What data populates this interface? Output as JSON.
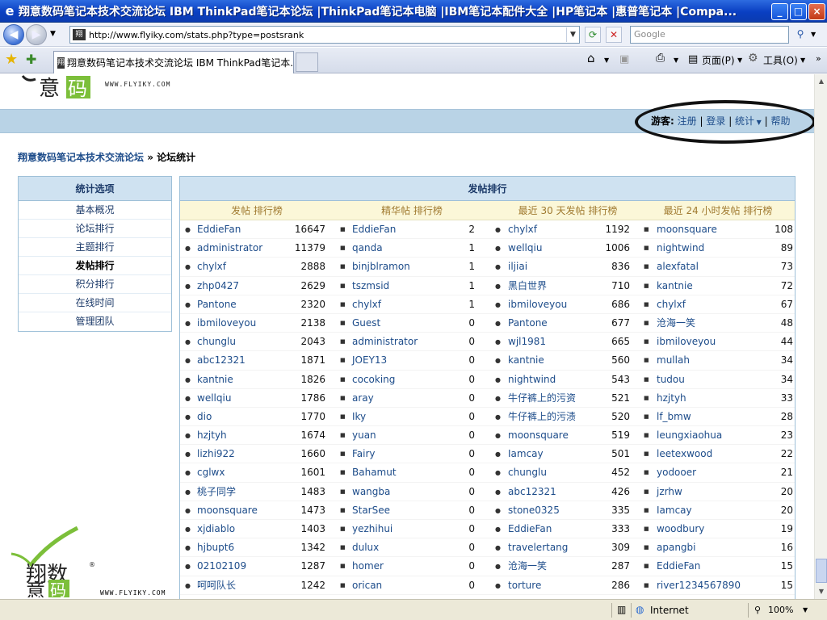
{
  "window": {
    "title": "翔意数码笔记本技术交流论坛 IBM ThinkPad笔记本论坛 |ThinkPad笔记本电脑 |IBM笔记本配件大全 |HP笔记本 |惠普笔记本 |Compa...",
    "app_icon": "ie-icon"
  },
  "browser": {
    "url": "http://www.flyiky.com/stats.php?type=postsrank",
    "search_placeholder": "Google",
    "tab_title": "翔意数码笔记本技术交流论坛 IBM ThinkPad笔记本...",
    "page_menu": "页面(P)",
    "tools_menu": "工具(O)",
    "zone": "Internet",
    "zoom": "100%"
  },
  "site": {
    "logo_url_text": "WWW.FLYIKY.COM",
    "guest_label": "游客:",
    "register": "注册",
    "login": "登录",
    "stats": "统计",
    "help": "帮助",
    "breadcrumb_home": "翔意数码笔记本技术交流论坛",
    "breadcrumb_sep": "»",
    "breadcrumb_current": "论坛统计"
  },
  "side_menu": {
    "title": "统计选项",
    "items": [
      "基本概况",
      "论坛排行",
      "主题排行",
      "发帖排行",
      "积分排行",
      "在线时间",
      "管理团队"
    ],
    "active_index": 3
  },
  "rank": {
    "title": "发帖排行",
    "columns": [
      "发帖 排行榜",
      "精华帖 排行榜",
      "最近 30 天发帖 排行榜",
      "最近 24 小时发帖 排行榜"
    ],
    "col1": [
      [
        "EddieFan",
        "16647"
      ],
      [
        "administrator",
        "11379"
      ],
      [
        "chylxf",
        "2888"
      ],
      [
        "zhp0427",
        "2629"
      ],
      [
        "Pantone",
        "2320"
      ],
      [
        "ibmiloveyou",
        "2138"
      ],
      [
        "chunglu",
        "2043"
      ],
      [
        "abc12321",
        "1871"
      ],
      [
        "kantnie",
        "1826"
      ],
      [
        "wellqiu",
        "1786"
      ],
      [
        "dio",
        "1770"
      ],
      [
        "hzjtyh",
        "1674"
      ],
      [
        "lizhi922",
        "1660"
      ],
      [
        "cglwx",
        "1601"
      ],
      [
        "桃子同学",
        "1483"
      ],
      [
        "moonsquare",
        "1473"
      ],
      [
        "xjdiablo",
        "1403"
      ],
      [
        "hjbupt6",
        "1342"
      ],
      [
        "02102109",
        "1287"
      ],
      [
        "呵呵队长",
        "1242"
      ]
    ],
    "col2": [
      [
        "EddieFan",
        "2"
      ],
      [
        "qanda",
        "1"
      ],
      [
        "binjblramon",
        "1"
      ],
      [
        "tszmsid",
        "1"
      ],
      [
        "chylxf",
        "1"
      ],
      [
        "Guest",
        "0"
      ],
      [
        "administrator",
        "0"
      ],
      [
        "JOEY13",
        "0"
      ],
      [
        "cocoking",
        "0"
      ],
      [
        "aray",
        "0"
      ],
      [
        "Iky",
        "0"
      ],
      [
        "yuan",
        "0"
      ],
      [
        "Fairy",
        "0"
      ],
      [
        "Bahamut",
        "0"
      ],
      [
        "wangba",
        "0"
      ],
      [
        "StarSee",
        "0"
      ],
      [
        "yezhihui",
        "0"
      ],
      [
        "dulux",
        "0"
      ],
      [
        "homer",
        "0"
      ],
      [
        "orican",
        "0"
      ]
    ],
    "col3": [
      [
        "chylxf",
        "1192"
      ],
      [
        "wellqiu",
        "1006"
      ],
      [
        "iljiai",
        "836"
      ],
      [
        "黑白世界",
        "710"
      ],
      [
        "ibmiloveyou",
        "686"
      ],
      [
        "Pantone",
        "677"
      ],
      [
        "wjl1981",
        "665"
      ],
      [
        "kantnie",
        "560"
      ],
      [
        "nightwind",
        "543"
      ],
      [
        "牛仔裤上的污资",
        "521"
      ],
      [
        "牛仔裤上的污渍",
        "520"
      ],
      [
        "moonsquare",
        "519"
      ],
      [
        "Iamcay",
        "501"
      ],
      [
        "chunglu",
        "452"
      ],
      [
        "abc12321",
        "426"
      ],
      [
        "stone0325",
        "335"
      ],
      [
        "EddieFan",
        "333"
      ],
      [
        "travelertang",
        "309"
      ],
      [
        "沧海一笑",
        "287"
      ],
      [
        "torture",
        "286"
      ]
    ],
    "col4": [
      [
        "moonsquare",
        "108"
      ],
      [
        "nightwind",
        "89"
      ],
      [
        "alexfatal",
        "73"
      ],
      [
        "kantnie",
        "72"
      ],
      [
        "chylxf",
        "67"
      ],
      [
        "沧海一笑",
        "48"
      ],
      [
        "ibmiloveyou",
        "44"
      ],
      [
        "mullah",
        "34"
      ],
      [
        "tudou",
        "34"
      ],
      [
        "hzjtyh",
        "33"
      ],
      [
        "lf_bmw",
        "28"
      ],
      [
        "leungxiaohua",
        "23"
      ],
      [
        "leetexwood",
        "22"
      ],
      [
        "yodooer",
        "21"
      ],
      [
        "jzrhw",
        "20"
      ],
      [
        "Iamcay",
        "20"
      ],
      [
        "woodbury",
        "19"
      ],
      [
        "apangbi",
        "16"
      ],
      [
        "EddieFan",
        "15"
      ],
      [
        "river1234567890",
        "15"
      ]
    ]
  }
}
